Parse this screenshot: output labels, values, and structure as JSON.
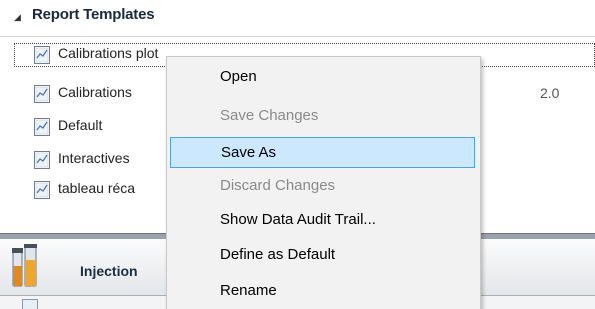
{
  "tree": {
    "title": "Report Templates",
    "rows": [
      {
        "label": "Calibrations plot",
        "version": "",
        "selected": true
      },
      {
        "label": "Calibrations",
        "version": "2.0",
        "selected": false
      },
      {
        "label": "Default",
        "version": "",
        "selected": false
      },
      {
        "label": "Interactives",
        "version": "",
        "selected": false
      },
      {
        "label": "tableau réca",
        "version": "",
        "selected": false
      }
    ]
  },
  "section": {
    "label": "Injection",
    "icon": "injection-vials-icon"
  },
  "context_menu": {
    "items": [
      {
        "label": "Open",
        "enabled": true,
        "highlighted": false
      },
      {
        "label": "Save Changes",
        "enabled": false,
        "highlighted": false
      },
      {
        "label": "Save As",
        "enabled": true,
        "highlighted": true
      },
      {
        "label": "Discard Changes",
        "enabled": false,
        "highlighted": false
      },
      {
        "label": "Show Data Audit Trail...",
        "enabled": true,
        "highlighted": false
      },
      {
        "label": "Define as Default",
        "enabled": true,
        "highlighted": false
      },
      {
        "label": "Rename",
        "enabled": true,
        "highlighted": false
      }
    ]
  },
  "colors": {
    "menu_highlight": "#cce8ff",
    "menu_highlight_border": "#4da3e6",
    "disabled_text": "#8a8a8a"
  }
}
